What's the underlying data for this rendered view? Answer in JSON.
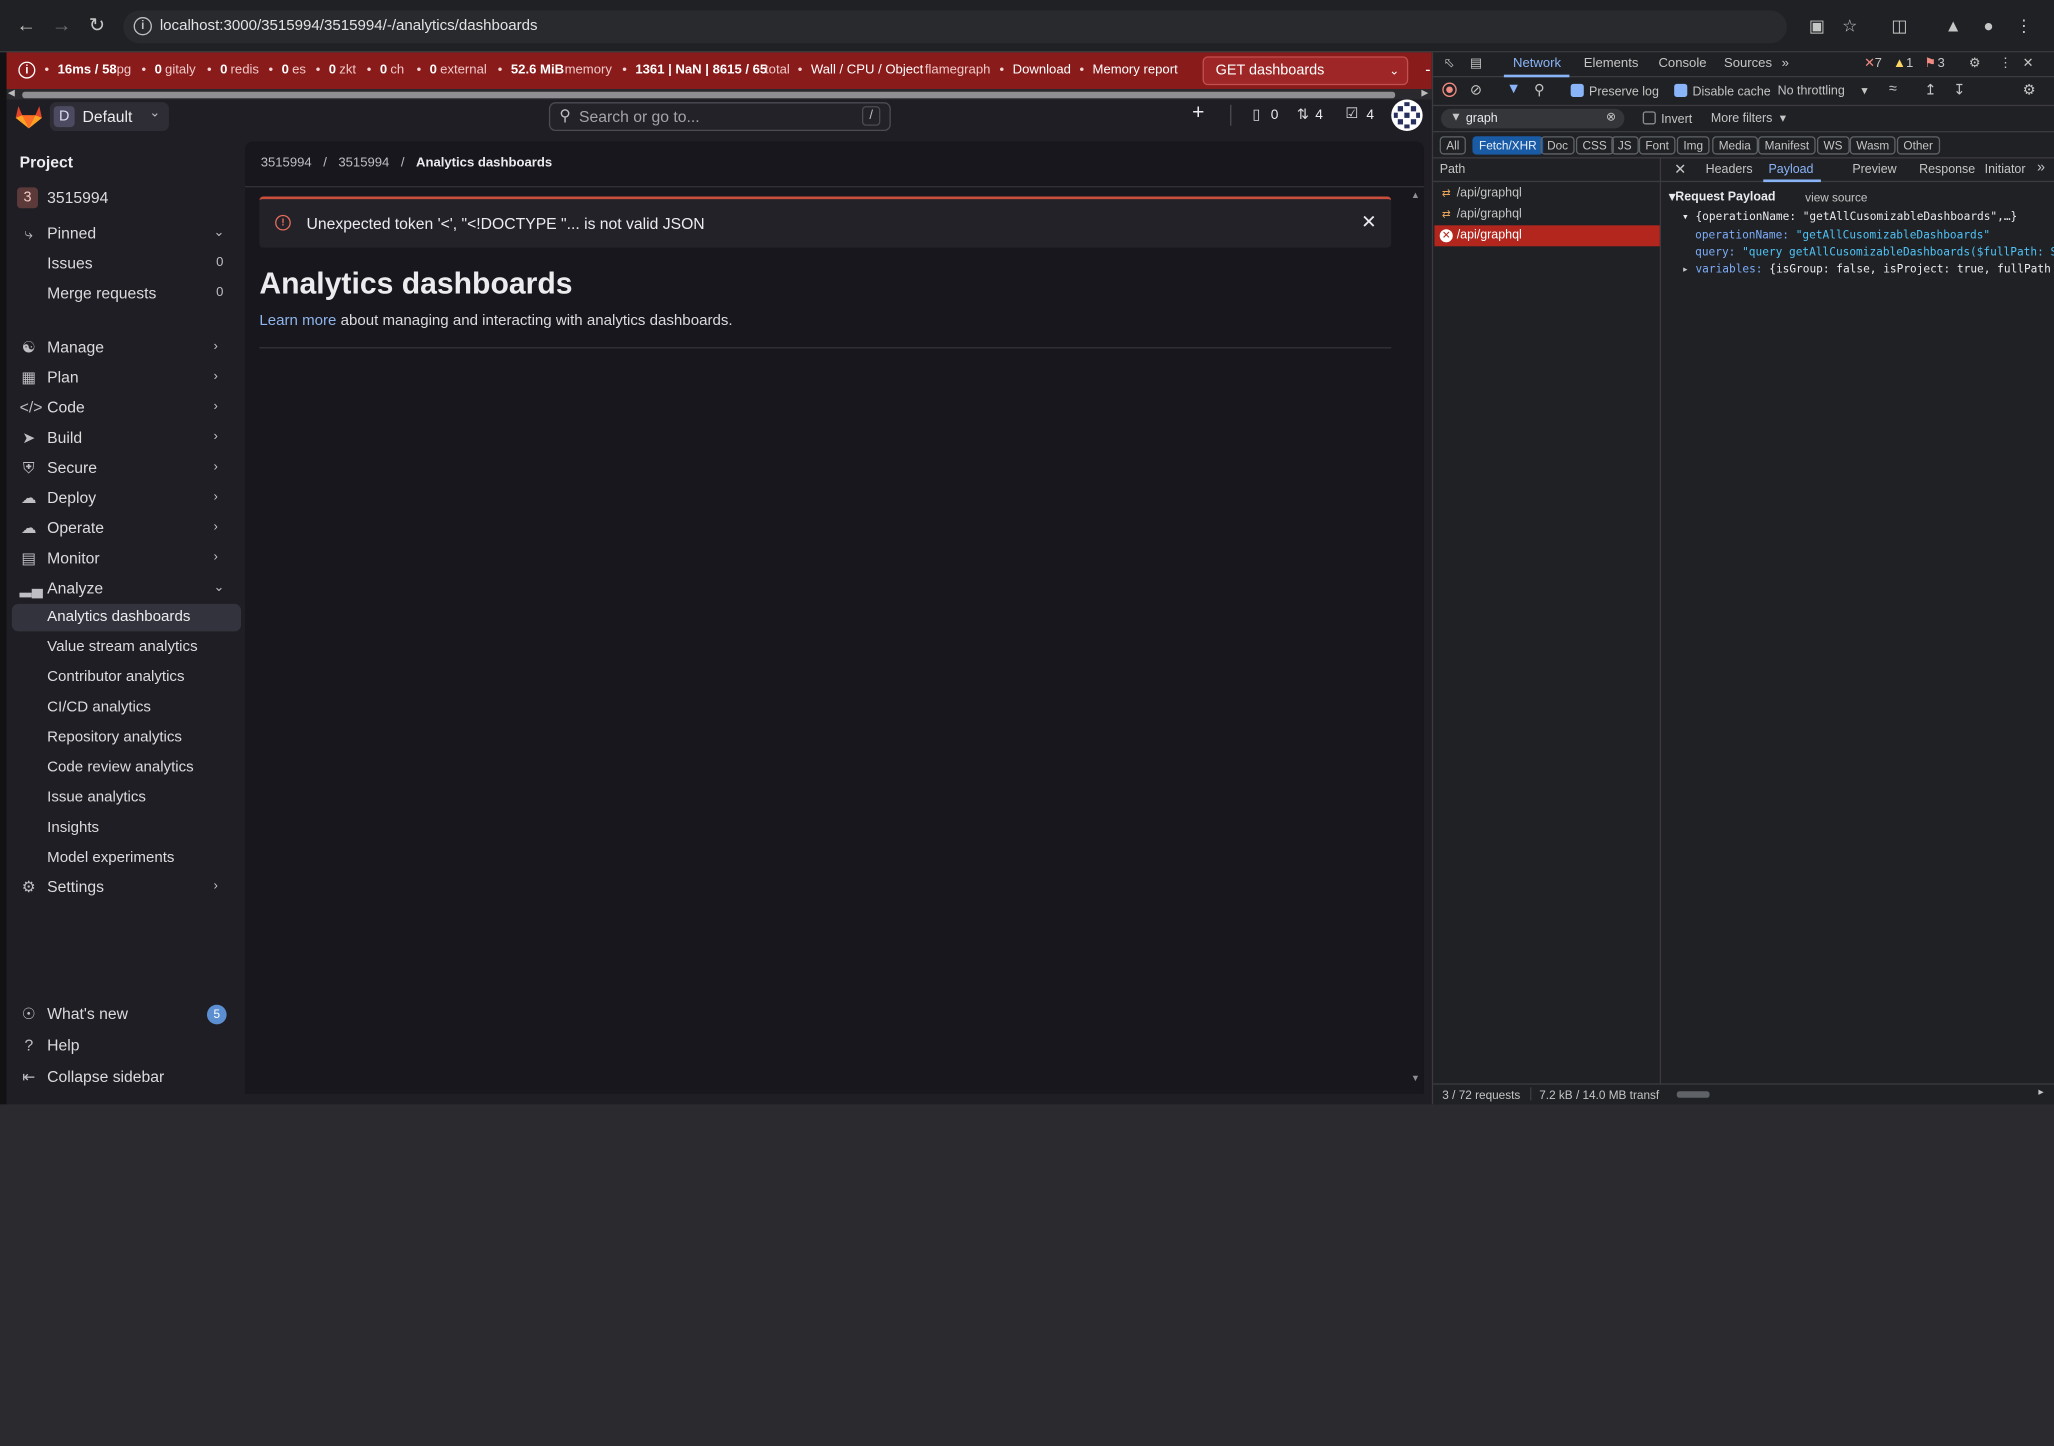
{
  "browser": {
    "url": "localhost:3000/3515994/3515994/-/analytics/dashboards"
  },
  "perf_bar": {
    "pg_time": "16ms / 58",
    "pg_label": "pg",
    "gitaly_count": "0",
    "gitaly_label": "gitaly",
    "redis_count": "0",
    "redis_label": "redis",
    "es_count": "0",
    "es_label": "es",
    "zkt_count": "0",
    "zkt_label": "zkt",
    "ch_count": "0",
    "ch_label": "ch",
    "external_count": "0",
    "external_label": "external",
    "memory_value": "52.6 MiB",
    "memory_label": "memory",
    "total_value": "1361 | NaN | 8615 / 65",
    "total_label": "total",
    "flamegraph_prefix": "Wall / CPU / Object",
    "flamegraph_label": "flamegraph",
    "download_label": "Download",
    "memory_report_label": "Memory report",
    "request_select": "GET dashboards"
  },
  "topbar": {
    "context_initial": "D",
    "context_name": "Default",
    "search_placeholder": "Search or go to...",
    "search_shortcut": "/",
    "issues_count": "0",
    "mr_count": "4",
    "todo_count": "4"
  },
  "sidebar": {
    "section_label": "Project",
    "project_initial": "3",
    "project_name": "3515994",
    "pinned_label": "Pinned",
    "pinned_items": [
      {
        "label": "Issues",
        "count": "0"
      },
      {
        "label": "Merge requests",
        "count": "0"
      }
    ],
    "groups": [
      {
        "label": "Manage",
        "icon": "users-icon"
      },
      {
        "label": "Plan",
        "icon": "calendar-icon"
      },
      {
        "label": "Code",
        "icon": "code-icon"
      },
      {
        "label": "Build",
        "icon": "rocket-icon"
      },
      {
        "label": "Secure",
        "icon": "shield-icon"
      },
      {
        "label": "Deploy",
        "icon": "deploy-icon"
      },
      {
        "label": "Operate",
        "icon": "cloud-icon"
      },
      {
        "label": "Monitor",
        "icon": "monitor-icon"
      },
      {
        "label": "Analyze",
        "icon": "chart-icon"
      }
    ],
    "analyze_items": [
      {
        "label": "Analytics dashboards",
        "active": true
      },
      {
        "label": "Value stream analytics"
      },
      {
        "label": "Contributor analytics"
      },
      {
        "label": "CI/CD analytics"
      },
      {
        "label": "Repository analytics"
      },
      {
        "label": "Code review analytics"
      },
      {
        "label": "Issue analytics"
      },
      {
        "label": "Insights"
      },
      {
        "label": "Model experiments"
      }
    ],
    "settings_label": "Settings",
    "whats_new_label": "What's new",
    "whats_new_count": "5",
    "help_label": "Help",
    "collapse_label": "Collapse sidebar"
  },
  "main": {
    "breadcrumbs": [
      "3515994",
      "3515994",
      "Analytics dashboards"
    ],
    "alert_message": "Unexpected token '<', \"<!DOCTYPE \"... is not valid JSON",
    "page_title": "Analytics dashboards",
    "learn_more_link": "Learn more",
    "description_rest": "about managing and interacting with analytics dashboards."
  },
  "devtools": {
    "tabs": [
      "Network",
      "Elements",
      "Console",
      "Sources"
    ],
    "error_count": "7",
    "warning_count": "1",
    "issue_count": "3",
    "preserve_log_label": "Preserve log",
    "disable_cache_label": "Disable cache",
    "throttling_label": "No throttling",
    "filter_value": "graph",
    "invert_label": "Invert",
    "more_filters_label": "More filters",
    "type_filters": [
      "All",
      "Fetch/XHR",
      "Doc",
      "CSS",
      "JS",
      "Font",
      "Img",
      "Media",
      "Manifest",
      "WS",
      "Wasm",
      "Other"
    ],
    "active_type_filter": "Fetch/XHR",
    "path_header": "Path",
    "requests": [
      {
        "path": "/api/graphql",
        "error": false
      },
      {
        "path": "/api/graphql",
        "error": false
      },
      {
        "path": "/api/graphql",
        "error": true
      }
    ],
    "detail_tabs": [
      "Headers",
      "Payload",
      "Preview",
      "Response",
      "Initiator"
    ],
    "active_detail_tab": "Payload",
    "payload_title": "Request Payload",
    "view_source_label": "view source",
    "payload_summary": "{operationName: \"getAllCusomizableDashboards\",…}",
    "operation_name_key": "operationName:",
    "operation_name_value": "\"getAllCusomizableDashboards\"",
    "query_key": "query:",
    "query_value": "\"query getAllCusomizableDashboards($fullPath: S",
    "variables_key": "variables:",
    "variables_value": "{isGroup: false, isProject: true, fullPath",
    "status_requests": "3 / 72 requests",
    "status_transfer": "7.2 kB / 14.0 MB transf"
  },
  "colors": {
    "perf_bar_bg": "#8a1b1b",
    "accent_blue": "#1a5ba5",
    "error_red": "#b3261e",
    "alert_border": "#c94e3c"
  }
}
